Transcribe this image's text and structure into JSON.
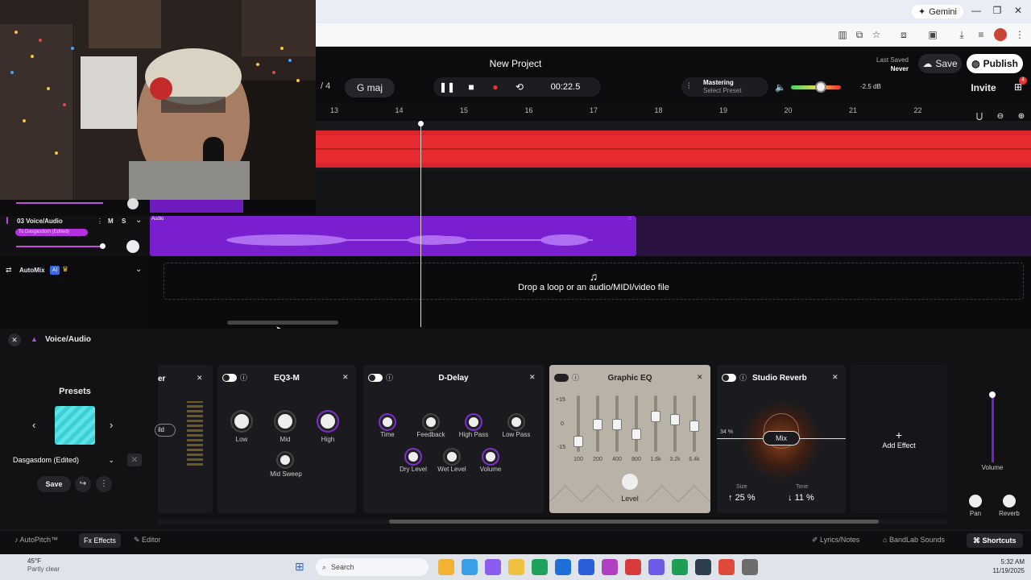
{
  "browser": {
    "gemini_label": "Gemini"
  },
  "project": {
    "title": "New Project",
    "last_saved_label": "Last Saved",
    "last_saved_value": "Never",
    "save_label": "Save",
    "publish_label": "Publish",
    "invite_label": "Invite",
    "gift_badge": "4"
  },
  "transport": {
    "meter": "4",
    "key": "G maj",
    "time": "00:22.5",
    "mastering_label": "Mastering",
    "mastering_preset": "Select Preset",
    "volume_db": "-2.5 dB"
  },
  "ruler": {
    "bars": [
      "13",
      "14",
      "15",
      "16",
      "17",
      "18",
      "19",
      "20",
      "21",
      "22"
    ]
  },
  "tracks": [
    {
      "number": "03",
      "name": "Voice/Audio",
      "mute": "M",
      "solo": "S",
      "preset_tag": "To Dasgasdom (Edited)",
      "clip_label": "Audio"
    }
  ],
  "automix": {
    "label": "AutoMix",
    "ai_badge": "AI"
  },
  "drop": {
    "text": "Drop a loop or an audio/MIDI/video file"
  },
  "panel": {
    "track_name": "Voice/Audio",
    "presets_label": "Presets",
    "preset_name": "Dasgasdom (Edited)",
    "save_label": "Save"
  },
  "effects": {
    "partial_title": "er",
    "partial_value": "ild",
    "eq3": {
      "title": "EQ3-M",
      "knobs": [
        "Low",
        "Mid",
        "High"
      ],
      "extra": "Mid Sweep"
    },
    "delay": {
      "title": "D-Delay",
      "row1": [
        "Time",
        "Feedback",
        "High Pass",
        "Low Pass"
      ],
      "row2": [
        "Dry Level",
        "Wet Level",
        "Volume"
      ]
    },
    "geq": {
      "title": "Graphic EQ",
      "scale": [
        "+15",
        "0",
        "-15"
      ],
      "bands": [
        "100",
        "200",
        "400",
        "800",
        "1.6k",
        "3.2k",
        "6.4k"
      ],
      "band_levels": [
        -0.6,
        0.1,
        0.1,
        -0.3,
        0.45,
        0.3,
        0.05
      ],
      "level_label": "Level"
    },
    "reverb": {
      "title": "Studio Reverb",
      "mix_pct": "34 %",
      "mix_label": "Mix",
      "size_label": "Size",
      "size_value": "25 %",
      "tone_label": "Tone",
      "tone_value": "11 %"
    },
    "add_label": "Add Effect"
  },
  "mixer": {
    "volume_label": "Volume",
    "pan_label": "Pan",
    "reverb_label": "Reverb"
  },
  "footer": {
    "autopitch": "AutoPitch™",
    "effects": "Effects",
    "editor": "Editor",
    "lyrics": "Lyrics/Notes",
    "sounds": "BandLab Sounds",
    "shortcuts": "Shortcuts"
  },
  "taskbar": {
    "weather_temp": "45°F",
    "weather_text": "Partly clear",
    "search": "Search",
    "time": "5:32 AM",
    "date": "11/19/2025"
  },
  "colors": {
    "accent": "#7a1fd0",
    "red_track": "#d9252b"
  }
}
